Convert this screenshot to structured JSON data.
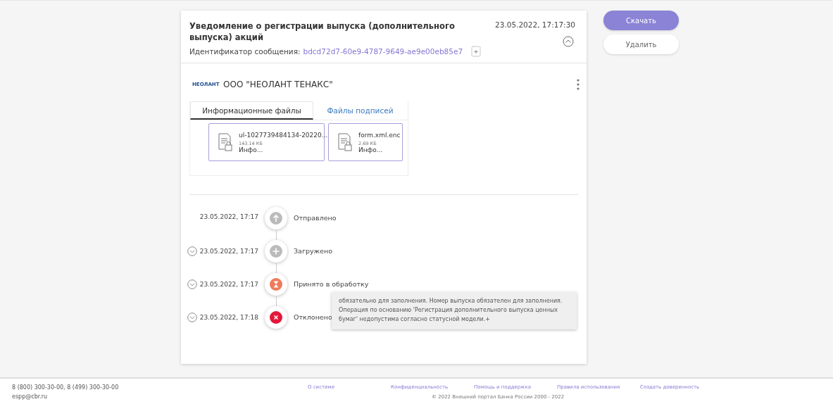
{
  "notice": {
    "title": "Уведомление о регистрации выпуска (дополнительного выпуска) акций",
    "datetime": "23.05.2022, 17:17:30",
    "expanded": true,
    "id_label": "Идентификатор сообщения:",
    "id_value": "bdcd72d7-60e9-4787-9649-ae9e00eb85e7"
  },
  "organization": {
    "logo_text": "НЕОЛАНТ",
    "name": "ООО \"НЕОЛАНТ ТЕНАКС\""
  },
  "tabs": [
    {
      "label": "Информационные файлы",
      "selected": true
    },
    {
      "label": "Файлы подписей",
      "selected": false
    }
  ],
  "files": [
    {
      "name": "ul-1027739484134-20220...",
      "size": "143.14 КБ",
      "type": "Инфо..."
    },
    {
      "name": "form.xml.enc",
      "size": "2.69 КБ",
      "type": "Инфо..."
    }
  ],
  "timeline": [
    {
      "datetime": "23.05.2022, 17:17",
      "status": "Отправлено",
      "kind": "sent",
      "expandable": false
    },
    {
      "datetime": "23.05.2022, 17:17",
      "status": "Загружено",
      "kind": "loaded",
      "expandable": true
    },
    {
      "datetime": "23.05.2022, 17:17",
      "status": "Принято в обработку",
      "kind": "processing",
      "expandable": true
    },
    {
      "datetime": "23.05.2022, 17:18",
      "status": "Отклонено",
      "kind": "rejected",
      "expandable": true,
      "tooltip": "обязательно для заполнения. Номер выпуска обязателен для заполнения. Операция по основанию 'Регистрация дополнительного выпуска ценных бумаг' недопустима согласно статусной модели.+"
    }
  ],
  "actions": [
    {
      "label": "Скачать",
      "kind": "primary"
    },
    {
      "label": "Удалить",
      "kind": "secondary"
    }
  ],
  "footer": {
    "phones": "8 (800) 300-30-00, 8 (499) 300-30-00",
    "email": "espp@cbr.ru",
    "links": [
      "О системе",
      "Конфиденциальность",
      "Помощь и поддержка",
      "Правила использования",
      "Создать доверенность"
    ],
    "copyright": "© 2022 Внешний портал Банка России 2000 - 2022"
  }
}
